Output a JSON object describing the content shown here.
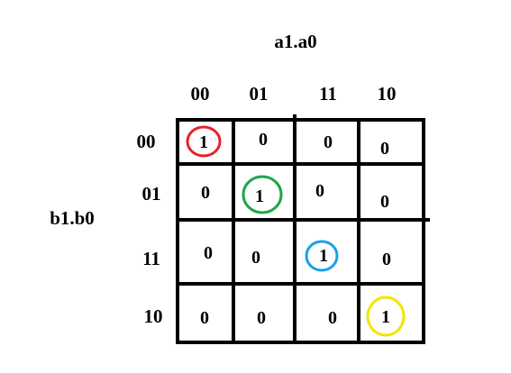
{
  "col_variable": "a1.a0",
  "row_variable": "b1.b0",
  "col_headers": [
    "00",
    "01",
    "11",
    "10"
  ],
  "row_headers": [
    "00",
    "01",
    "11",
    "10"
  ],
  "cells": [
    [
      "1",
      "0",
      "0",
      "0"
    ],
    [
      "0",
      "1",
      "0",
      "0"
    ],
    [
      "0",
      "0",
      "1",
      "0"
    ],
    [
      "0",
      "0",
      "0",
      "1"
    ]
  ],
  "circles": [
    {
      "row": 0,
      "col": 0,
      "color": "#e8202a",
      "color_name": "red"
    },
    {
      "row": 1,
      "col": 1,
      "color": "#1ea64a",
      "color_name": "green"
    },
    {
      "row": 2,
      "col": 2,
      "color": "#1aa0e6",
      "color_name": "blue"
    },
    {
      "row": 3,
      "col": 3,
      "color": "#f2e600",
      "color_name": "yellow"
    }
  ]
}
